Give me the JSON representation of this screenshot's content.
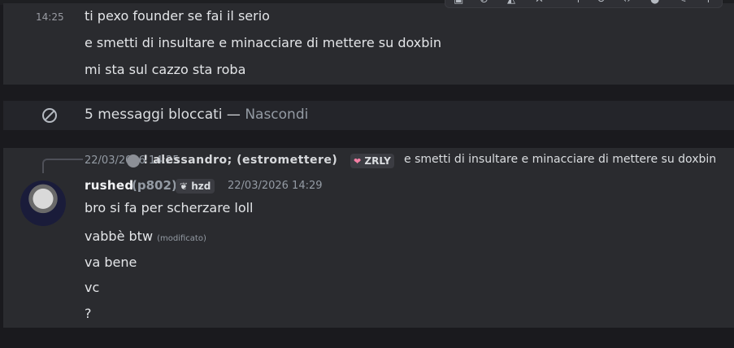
{
  "toolbar": {
    "icons": [
      "reaction-icon",
      "link-icon",
      "mention-icon",
      "close-x-icon",
      "plus-icon",
      "refresh-icon",
      "code-icon",
      "circle-icon",
      "edit-icon",
      "more-icon"
    ]
  },
  "messages_top": {
    "timestamp": "14:25",
    "lines": [
      "ti pexo founder se fai il serio",
      "e smetti di insultare e minacciare di mettere su doxbin",
      "mi sta sul cazzo sta roba"
    ]
  },
  "blocked": {
    "text": "5 messaggi bloccati — ",
    "hide": "Nascondi"
  },
  "reply": {
    "time": "22/03/2026 14:25",
    "name": "! alessandro; (estromettere)",
    "tag": "ZRLY",
    "message": "e smetti di insultare e minacciare di mettere su doxbin"
  },
  "author": {
    "name": "rushed",
    "sub": "(p802)",
    "tag": "hzd",
    "time": "22/03/2026 14:29"
  },
  "messages_bottom": [
    "bro si fa per scherzare loll",
    "vabbè btw",
    "va bene",
    "vc",
    "?"
  ],
  "edited_label": "(modificato)"
}
